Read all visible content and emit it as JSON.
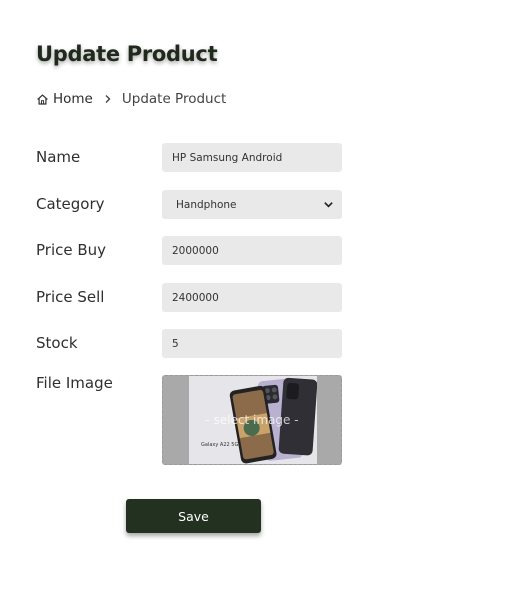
{
  "page": {
    "title": "Update Product"
  },
  "breadcrumb": {
    "home_label": "Home",
    "current_label": "Update Product"
  },
  "form": {
    "name": {
      "label": "Name",
      "value": "HP Samsung Android"
    },
    "category": {
      "label": "Category",
      "value": "Handphone"
    },
    "price_buy": {
      "label": "Price Buy",
      "value": "2000000"
    },
    "price_sell": {
      "label": "Price Sell",
      "value": "2400000"
    },
    "stock": {
      "label": "Stock",
      "value": "5"
    },
    "file_image": {
      "label": "File Image",
      "overlay_text": "- select image -",
      "preview_caption": "Galaxy A22 5G"
    },
    "save_label": "Save"
  },
  "colors": {
    "primary_dark": "#223120",
    "field_bg": "#e9e9e9"
  },
  "icons": {
    "home": "home-icon",
    "separator": "chevron-right-icon",
    "select": "chevron-down-icon"
  }
}
